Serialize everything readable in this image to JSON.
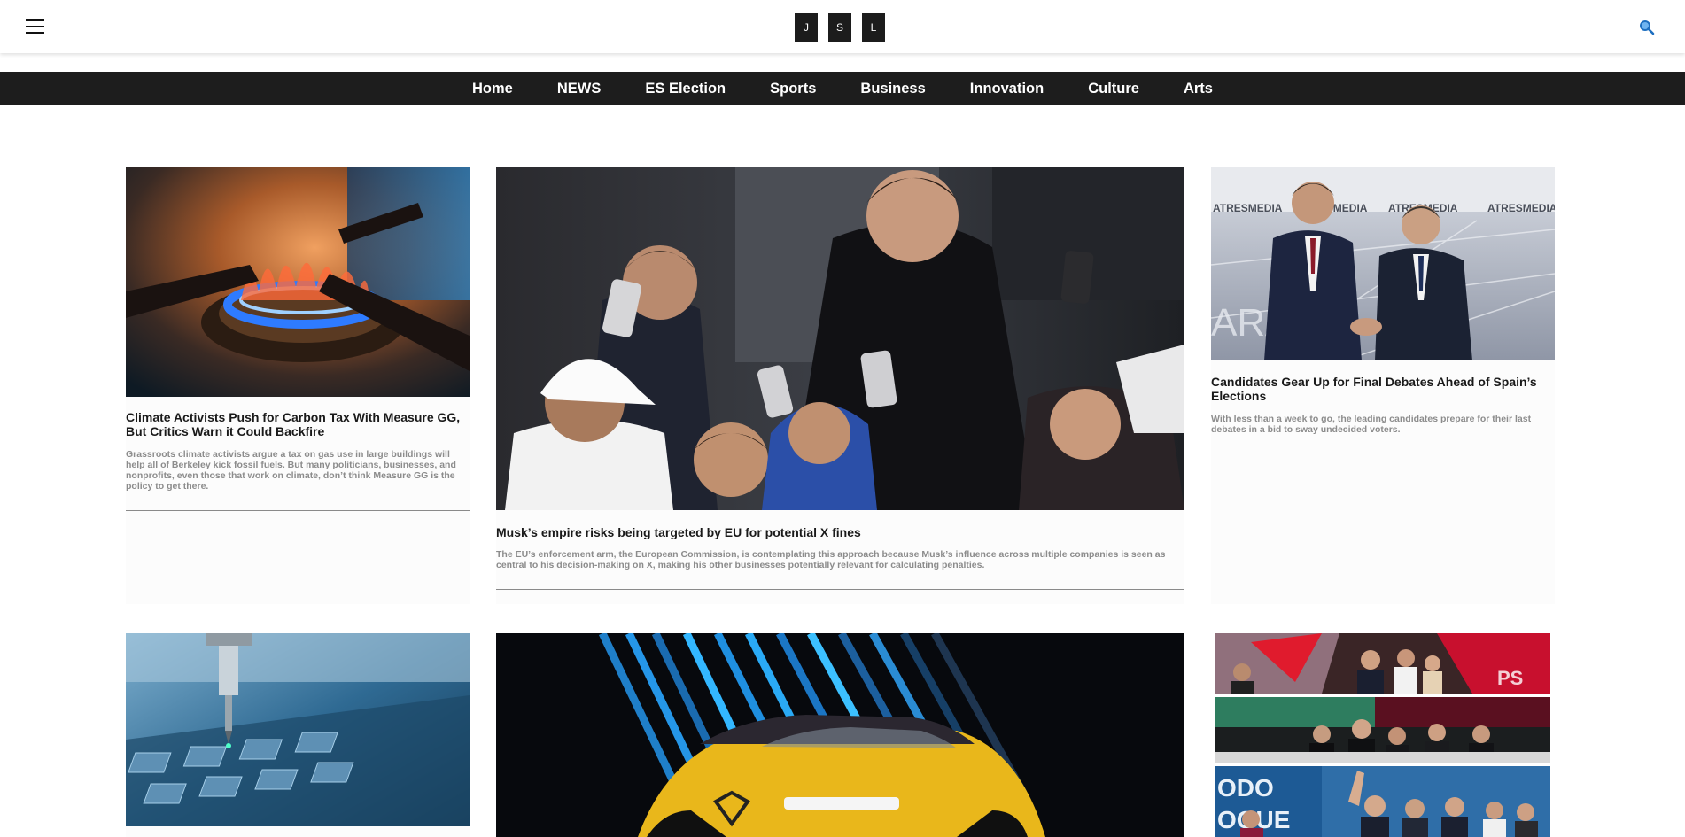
{
  "header": {
    "logo_letters": [
      "J",
      "S",
      "L"
    ],
    "menu_icon": "hamburger-menu-icon",
    "search_icon": "search-icon"
  },
  "nav": {
    "items": [
      "Home",
      "NEWS",
      "ES Election",
      "Sports",
      "Business",
      "Innovation",
      "Culture",
      "Arts"
    ]
  },
  "articles": {
    "gas": {
      "title": "Climate Activists Push for Carbon Tax With Measure GG, But Critics Warn it Could Backfire",
      "summary": "Grassroots climate activists argue a tax on gas use in large buildings will help all of Berkeley kick fossil fuels. But many politicians, businesses, and nonprofits, even those that work on climate, don’t think Measure GG is the policy to get there.",
      "image": "gas-stove-burner-flame"
    },
    "musk": {
      "title": "Musk’s empire risks being targeted by EU for potential X fines",
      "summary": "The EU’s enforcement arm, the European Commission, is contemplating this approach because Musk’s influence across multiple companies is seen as central to his decision-making on X, making his other businesses potentially relevant for calculating penalties.",
      "image": "crowd-taking-selfies-photo"
    },
    "debates": {
      "title": "Candidates Gear Up for Final Debates Ahead of Spain’s Elections",
      "summary": "With less than a week to go, the leading candidates prepare for their last debates in a bid to sway undecided voters.",
      "image": "candidates-handshake-photo",
      "backdrop_text": [
        "ATRESMEDIA",
        "ATRESMEDIA",
        "ATRESMEDIA",
        "ATRESMEDIA"
      ]
    },
    "chip": {
      "image": "circuit-board-machine-photo"
    },
    "car": {
      "image": "yellow-car-photo"
    },
    "election_strip": {
      "images": [
        "party-celebration-photo",
        "party-balcony-photo",
        "party-rally-photo"
      ]
    }
  },
  "colors": {
    "nav_background": "#1d1d1d",
    "logo_tile": "#1c1c1c",
    "summary_text": "#8c8c8c",
    "search_icon": "#1e88e5"
  }
}
